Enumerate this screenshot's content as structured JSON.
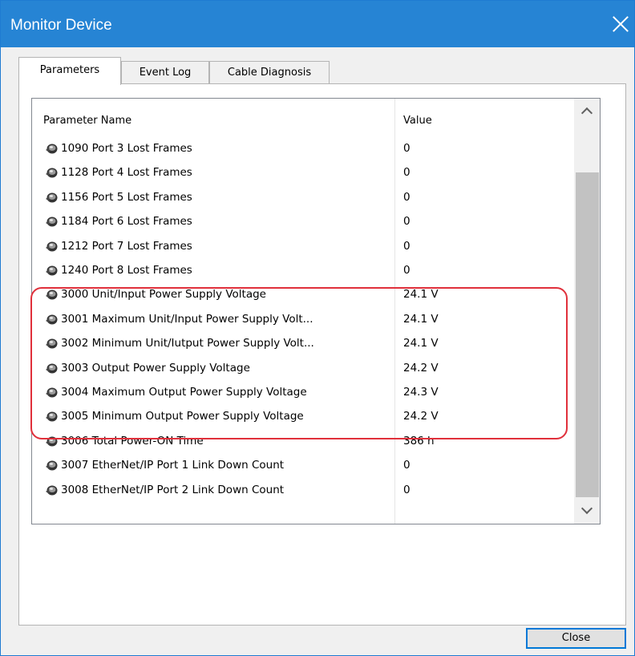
{
  "window": {
    "title": "Monitor Device"
  },
  "tabs": [
    {
      "label": "Parameters",
      "active": true
    },
    {
      "label": "Event Log",
      "active": false
    },
    {
      "label": "Cable Diagnosis",
      "active": false
    }
  ],
  "list": {
    "columns": [
      "Parameter Name",
      "Value"
    ],
    "rows": [
      {
        "name": "1090 Port 3 Lost Frames",
        "value": "0"
      },
      {
        "name": "1128 Port 4 Lost Frames",
        "value": "0"
      },
      {
        "name": "1156 Port 5 Lost Frames",
        "value": "0"
      },
      {
        "name": "1184 Port 6 Lost Frames",
        "value": "0"
      },
      {
        "name": "1212 Port 7 Lost Frames",
        "value": "0"
      },
      {
        "name": "1240 Port 8 Lost Frames",
        "value": "0"
      },
      {
        "name": "3000 Unit/Input Power Supply Voltage",
        "value": "24.1 V"
      },
      {
        "name": "3001 Maximum Unit/Input Power Supply Volt...",
        "value": "24.1 V"
      },
      {
        "name": "3002 Minimum Unit/Iutput Power Supply Volt...",
        "value": "24.1 V"
      },
      {
        "name": "3003 Output Power Supply Voltage",
        "value": "24.2 V"
      },
      {
        "name": "3004 Maximum Output Power Supply Voltage",
        "value": "24.3 V"
      },
      {
        "name": "3005 Minimum Output Power Supply Voltage",
        "value": "24.2 V"
      },
      {
        "name": "3006 Total Power-ON Time",
        "value": "386 h"
      },
      {
        "name": "3007 EtherNet/IP Port 1 Link Down Count",
        "value": "0"
      },
      {
        "name": "3008 EtherNet/IP Port 2 Link Down Count",
        "value": "0"
      }
    ],
    "row_icon": "parameter-icon"
  },
  "buttons": {
    "close_label": "Close"
  },
  "colors": {
    "titlebar": "#2684d4",
    "highlight": "#e0303b",
    "accent": "#0078d7"
  }
}
